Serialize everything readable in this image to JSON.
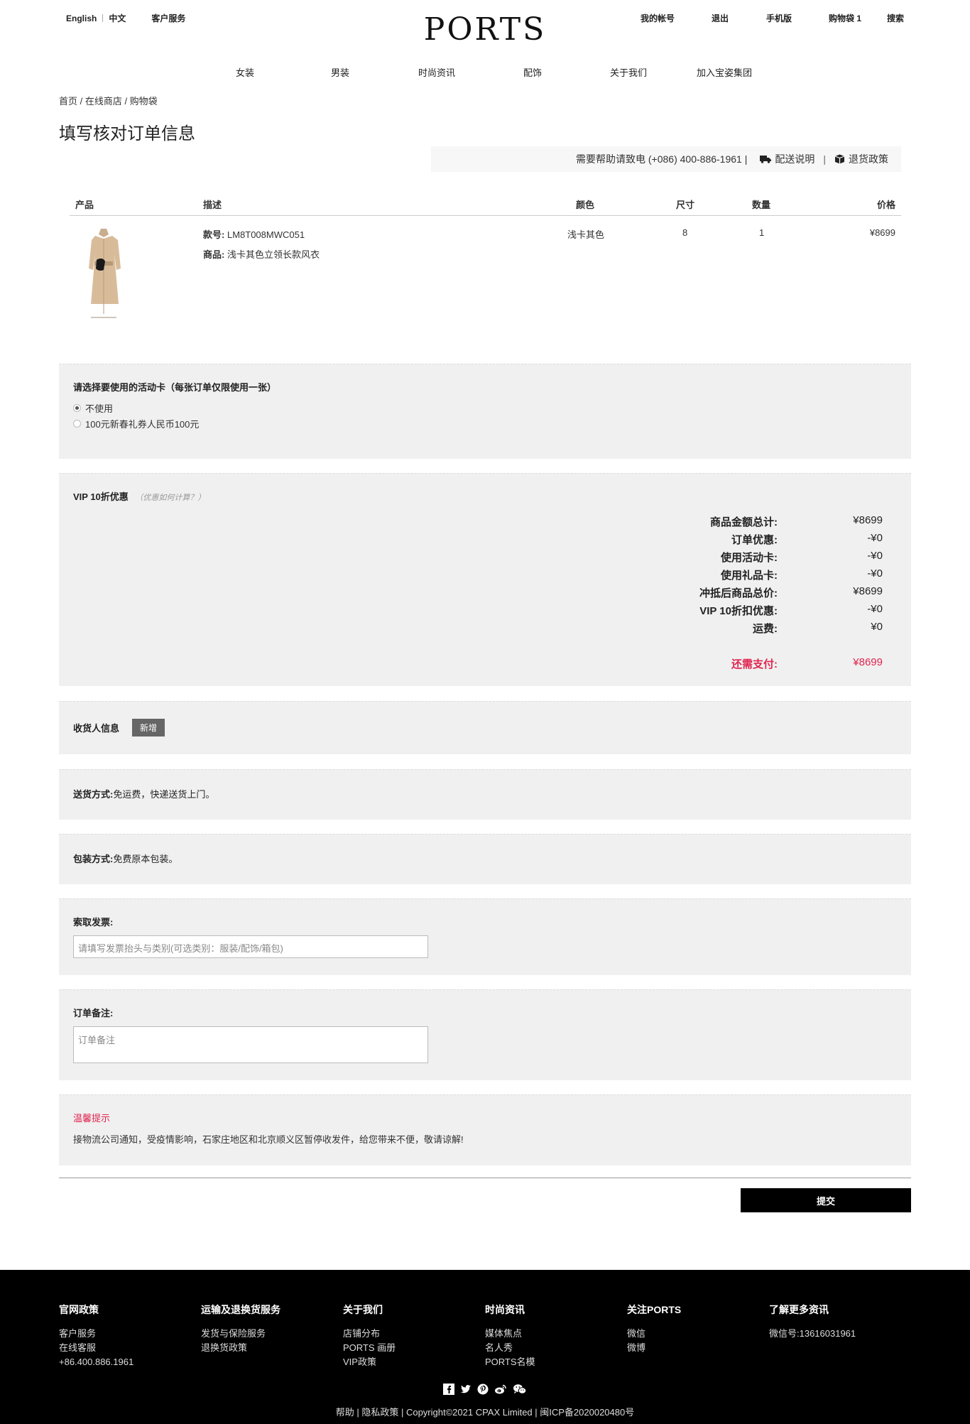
{
  "header": {
    "lang_en": "English",
    "lang_zh": "中文",
    "customer_service": "客户服务",
    "logo": "PORTS",
    "right_links": [
      "我的帐号",
      "退出",
      "手机版",
      "购物袋 1",
      "搜索"
    ],
    "nav": [
      "女装",
      "男装",
      "时尚资讯",
      "配饰",
      "关于我们",
      "加入宝姿集团"
    ]
  },
  "breadcrumb": "首页 / 在线商店 / 购物袋",
  "page_title": "填写核对订单信息",
  "help": {
    "phone_text": "需要帮助请致电 (+086) 400-886-1961 |",
    "delivery": "配送说明",
    "divider": "|",
    "returns": "退货政策",
    "truck_icon": "truck-icon",
    "box_icon": "box-icon"
  },
  "table": {
    "headers": [
      "产品",
      "描述",
      "颜色",
      "尺寸",
      "数量",
      "价格"
    ],
    "item": {
      "sku_label": "款号:",
      "sku": "LM8T008MWC051",
      "name_label": "商品:",
      "name": "浅卡其色立领长款风衣",
      "color": "浅卡其色",
      "size": "8",
      "qty": "1",
      "price": "¥8699"
    }
  },
  "coupon": {
    "title": "请选择要使用的活动卡（每张订单仅限使用一张）",
    "options": [
      "不使用",
      "100元新春礼券人民币100元"
    ],
    "selected": 0
  },
  "vip": {
    "title": "VIP 10折优惠",
    "hint": "（优惠如何计算？）",
    "rows": [
      {
        "k": "商品金额总计:",
        "v": "¥8699"
      },
      {
        "k": "订单优惠:",
        "v": "-¥0"
      },
      {
        "k": "使用活动卡:",
        "v": "-¥0"
      },
      {
        "k": "使用礼品卡:",
        "v": "-¥0"
      },
      {
        "k": "冲抵后商品总价:",
        "v": "¥8699"
      },
      {
        "k": "VIP 10折扣优惠:",
        "v": "-¥0"
      },
      {
        "k": "运费:",
        "v": "¥0"
      }
    ],
    "due_label": "还需支付:",
    "due_value": "¥8699"
  },
  "consignee": {
    "label": "收货人信息",
    "add_button": "新增"
  },
  "shipping": {
    "label": "送货方式:",
    "value": "免运费，快递送货上门。"
  },
  "packing": {
    "label": "包装方式:",
    "value": "免费原本包装。"
  },
  "invoice": {
    "label": "索取发票:",
    "placeholder": "请填写发票抬头与类别(可选类别：服装/配饰/箱包)"
  },
  "remarks": {
    "label": "订单备注:",
    "placeholder": "订单备注"
  },
  "notice": {
    "title": "温馨提示",
    "text": "接物流公司通知，受疫情影响，石家庄地区和北京顺义区暂停收发件，给您带来不便，敬请谅解!"
  },
  "submit": "提交",
  "footer": {
    "cols": [
      {
        "h": "官网政策",
        "links": [
          "客户服务",
          "在线客服",
          "+86.400.886.1961"
        ]
      },
      {
        "h": "运输及退换货服务",
        "links": [
          "发货与保险服务",
          "退换货政策"
        ]
      },
      {
        "h": "关于我们",
        "links": [
          "店铺分布",
          "PORTS 画册",
          "VIP政策"
        ]
      },
      {
        "h": "时尚资讯",
        "links": [
          "媒体焦点",
          "名人秀",
          "PORTS名模"
        ]
      },
      {
        "h": "关注PORTS",
        "links": [
          "微信",
          "微博"
        ]
      },
      {
        "h": "了解更多资讯",
        "links": [
          "微信号:13616031961"
        ]
      }
    ],
    "social_icons": [
      "facebook-icon",
      "twitter-icon",
      "pinterest-icon",
      "weibo-icon",
      "wechat-icon"
    ],
    "copyright": "帮助 | 隐私政策 | Copyright©2021 CPAX Limited | 闽ICP备2020020480号"
  },
  "colors": {
    "accent_red": "#e0244f",
    "footer_bg": "#000000",
    "section_bg": "#f0f0f0"
  }
}
